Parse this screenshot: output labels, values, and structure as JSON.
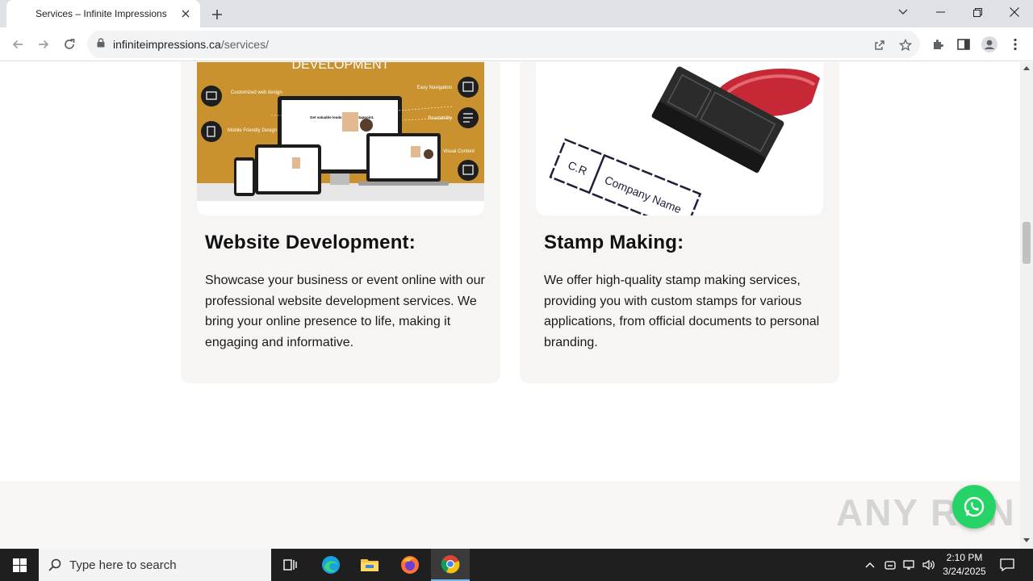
{
  "browser": {
    "tab_title": "Services – Infinite Impressions",
    "url_host": "infiniteimpressions.ca",
    "url_path": "/services/"
  },
  "cards": [
    {
      "title": "Website Development:",
      "description": "Showcase your business or event online with our professional website development services. We bring your online presence to life, making it engaging and informative.",
      "image": {
        "heading": "DEVELOPMENT",
        "features": [
          "Customized web design",
          "Mobile Friendly Design",
          "Easy Navigation",
          "Readability",
          "Visual Content"
        ],
        "screen_headline": "Get valuable leads using Instappoint."
      }
    },
    {
      "title": "Stamp Making:",
      "description": "We offer high-quality stamp making services, providing you with custom stamps for various applications, from official documents to personal branding.",
      "image": {
        "stamp_left": "C.R",
        "stamp_right": "Company Name"
      }
    }
  ],
  "watermark": "ANY RUN",
  "taskbar": {
    "search_placeholder": "Type here to search",
    "time": "2:10 PM",
    "date": "3/24/2025"
  },
  "colors": {
    "card_bg": "#f7f5f3",
    "whatsapp": "#25d366",
    "dev_banner": "#c9922e"
  }
}
